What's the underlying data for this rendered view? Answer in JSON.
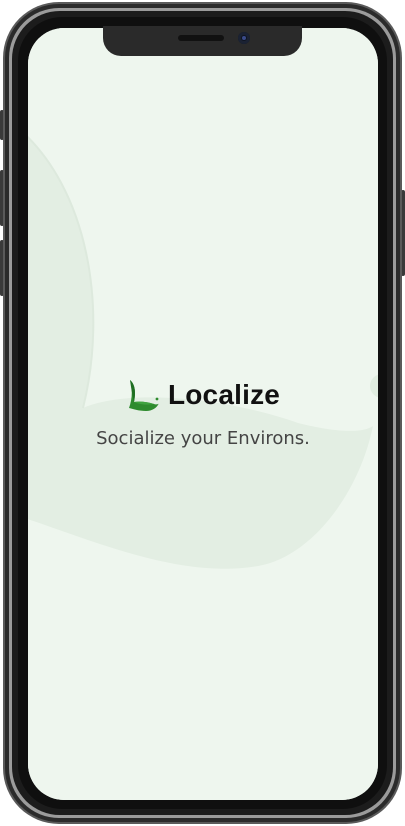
{
  "app": {
    "name": "Localize",
    "tagline": "Socialize your Environs."
  },
  "colors": {
    "screen_background": "#eef6ee",
    "accent_green": "#2e8b2e",
    "text_primary": "#111111",
    "text_secondary": "#444444"
  },
  "icons": {
    "logo": "leaf-L-logo-icon",
    "camera": "front-camera-icon",
    "speaker": "earpiece-speaker-icon"
  }
}
